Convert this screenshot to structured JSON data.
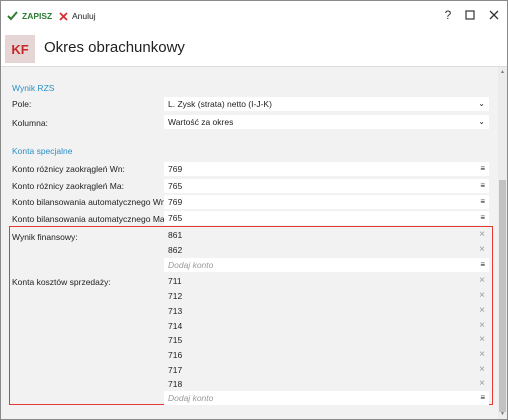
{
  "toolbar": {
    "save_label": "ZAPISZ",
    "cancel_label": "Anuluj"
  },
  "header": {
    "logo": "KF",
    "title": "Okres obrachunkowy"
  },
  "wynik_rzs": {
    "section_label": "Wynik RZS",
    "pole": {
      "label": "Pole:",
      "value": "L. Zysk (strata) netto (I-J-K)"
    },
    "kolumna": {
      "label": "Kolumna:",
      "value": "Wartość za okres"
    }
  },
  "konta_specjalne": {
    "section_label": "Konta specjalne",
    "rows": [
      {
        "label": "Konto różnicy zaokrągleń Wn:",
        "value": "769"
      },
      {
        "label": "Konto różnicy zaokrągleń Ma:",
        "value": "765"
      },
      {
        "label": "Konto bilansowania automatycznego Wn:",
        "value": "769"
      },
      {
        "label": "Konto bilansowania automatycznego Ma:",
        "value": "765"
      }
    ]
  },
  "wynik_finansowy": {
    "label": "Wynik finansowy:",
    "items": [
      "861",
      "862"
    ],
    "placeholder": "Dodaj konto"
  },
  "konta_kosztow": {
    "label": "Konta kosztów sprzedaży:",
    "items": [
      "711",
      "712",
      "713",
      "714",
      "715",
      "716",
      "717",
      "718"
    ],
    "placeholder": "Dodaj konto"
  },
  "colors": {
    "accent": "#2a8fc7",
    "save": "#2e7d32",
    "cancel": "#d32f2f",
    "highlight": "#e53935"
  }
}
